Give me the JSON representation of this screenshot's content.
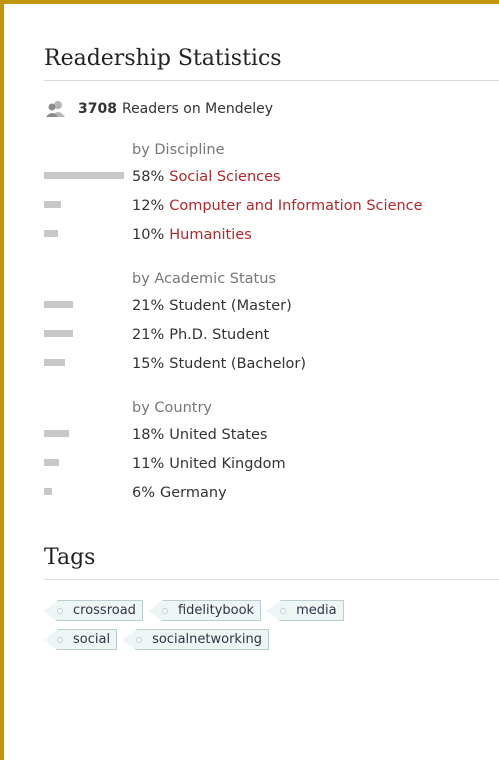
{
  "readership": {
    "title": "Readership Statistics",
    "readers_count": "3708",
    "readers_label": "Readers on Mendeley",
    "groups": [
      {
        "heading": "by Discipline",
        "rows": [
          {
            "pct": "58%",
            "label": "Social Sciences",
            "link": true,
            "value": 0.58
          },
          {
            "pct": "12%",
            "label": "Computer and Information Science",
            "link": true,
            "value": 0.12
          },
          {
            "pct": "10%",
            "label": "Humanities",
            "link": true,
            "value": 0.1
          }
        ]
      },
      {
        "heading": "by Academic Status",
        "rows": [
          {
            "pct": "21%",
            "label": "Student (Master)",
            "link": false,
            "value": 0.21
          },
          {
            "pct": "21%",
            "label": "Ph.D. Student",
            "link": false,
            "value": 0.21
          },
          {
            "pct": "15%",
            "label": "Student (Bachelor)",
            "link": false,
            "value": 0.15
          }
        ]
      },
      {
        "heading": "by Country",
        "rows": [
          {
            "pct": "18%",
            "label": "United States",
            "link": false,
            "value": 0.18
          },
          {
            "pct": "11%",
            "label": "United Kingdom",
            "link": false,
            "value": 0.11
          },
          {
            "pct": "6%",
            "label": "Germany",
            "link": false,
            "value": 0.06
          }
        ]
      }
    ]
  },
  "tags": {
    "title": "Tags",
    "items": [
      "crossroad",
      "fidelitybook",
      "media",
      "social",
      "socialnetworking"
    ]
  },
  "colors": {
    "frame_accent": "#c2960c",
    "link": "#b7262a",
    "bar": "#c7c7c7"
  }
}
